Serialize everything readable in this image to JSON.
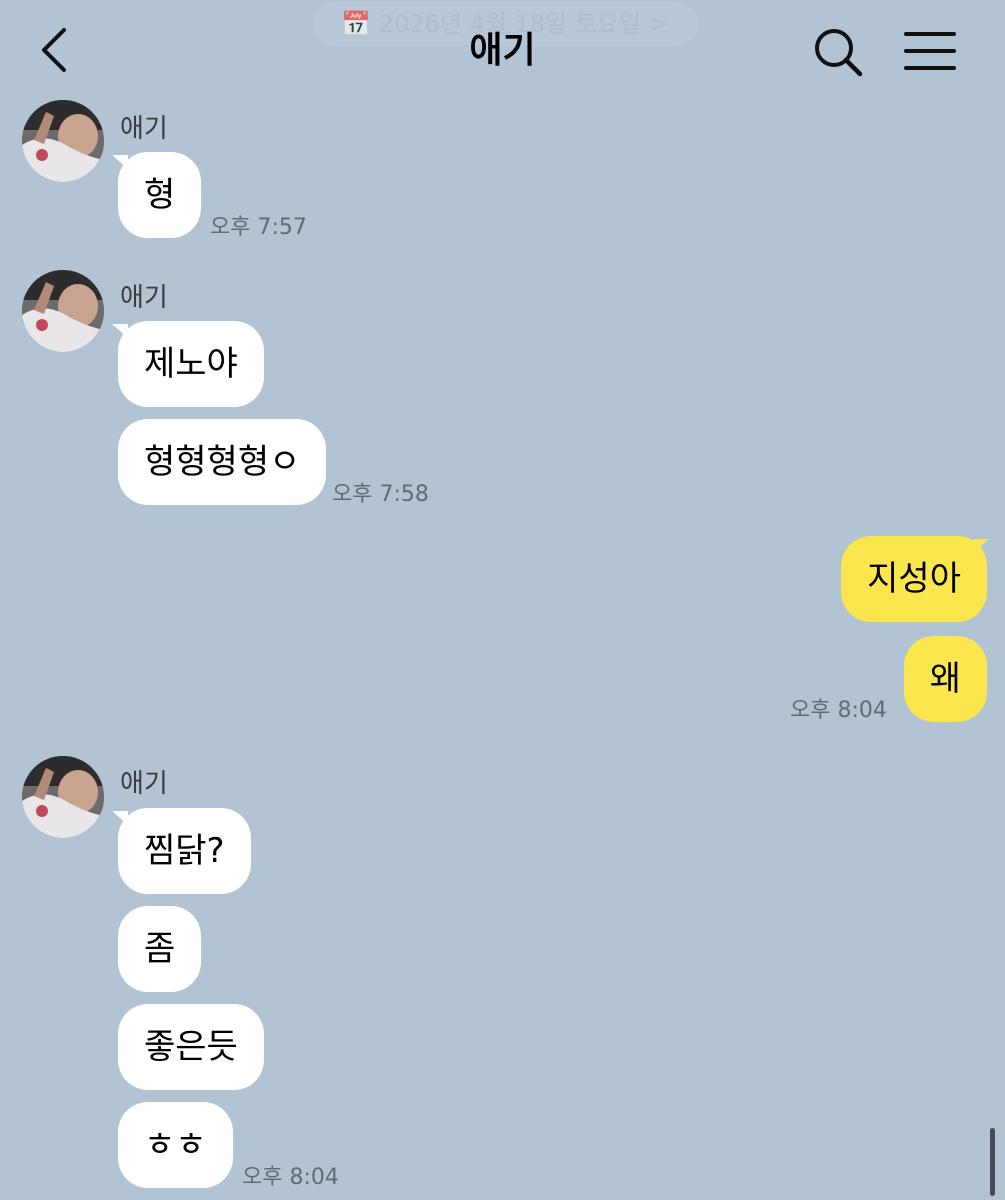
{
  "header": {
    "date": "📅 2026년 4월 18일 토요일 >",
    "title": "애기"
  },
  "messages": {
    "group1": {
      "sender": "애기",
      "msg1": "형",
      "time": "오후 7:57"
    },
    "group2": {
      "sender": "애기",
      "msg1": "제노야",
      "msg2": "형형형형ㅇ",
      "time": "오후 7:58"
    },
    "group3": {
      "msg1": "지성아",
      "msg2": "왜",
      "time": "오후 8:04"
    },
    "group4": {
      "sender": "애기",
      "msg1": "찜닭?",
      "msg2": "좀",
      "msg3": "좋은듯",
      "msg4": "ㅎㅎ",
      "time": "오후 8:04"
    }
  },
  "colors": {
    "background": "#b2c3d4",
    "incoming_bubble": "#ffffff",
    "outgoing_bubble": "#fbe74d"
  },
  "icons": [
    "back-arrow-icon",
    "search-icon",
    "menu-icon",
    "avatar-image"
  ]
}
